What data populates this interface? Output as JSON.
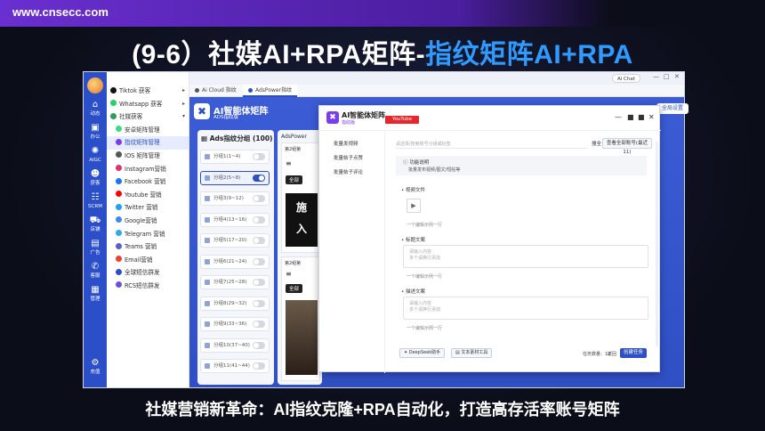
{
  "site_url": "www.cnsecc.com",
  "headline": {
    "part1": "(9-6）社媒AI+RPA矩阵-",
    "part2": "指纹矩阵AI+RPA"
  },
  "caption": "社媒营销新革命：AI指纹克隆+RPA自动化，打造高存活率账号矩阵",
  "rail": [
    {
      "icon": "home-icon",
      "glyph": "⌂",
      "label": "动态"
    },
    {
      "icon": "briefcase-icon",
      "glyph": "▣",
      "label": "办公"
    },
    {
      "icon": "aigc-icon",
      "glyph": "✺",
      "label": "AIGC"
    },
    {
      "icon": "user-icon",
      "glyph": "☻",
      "label": "获客"
    },
    {
      "icon": "scrm-icon",
      "glyph": "☷",
      "label": "SCRM"
    },
    {
      "icon": "cart-icon",
      "glyph": "⛟",
      "label": "店铺"
    },
    {
      "icon": "ads-icon",
      "glyph": "▤",
      "label": "广告"
    },
    {
      "icon": "service-icon",
      "glyph": "✆",
      "label": "客服"
    },
    {
      "icon": "manage-icon",
      "glyph": "▦",
      "label": "管理"
    }
  ],
  "rail_bottom": {
    "icon": "settings-icon",
    "glyph": "⚙",
    "label": "充值"
  },
  "menu": [
    {
      "label": "Tiktok 获客",
      "sub": false,
      "color": "#111111",
      "arrow": "▸"
    },
    {
      "label": "Whatsapp 获客",
      "sub": false,
      "color": "#25d366",
      "arrow": "▸"
    },
    {
      "label": "社媒获客",
      "sub": false,
      "color": "#2f9b5a",
      "arrow": "▾"
    },
    {
      "label": "安卓矩阵管理",
      "sub": true,
      "color": "#3ddc84",
      "arrow": ""
    },
    {
      "label": "指纹矩阵管理",
      "sub": true,
      "color": "#7a3cf0",
      "arrow": "",
      "active": true
    },
    {
      "label": "IOS 矩阵管理",
      "sub": true,
      "color": "#555555",
      "arrow": ""
    },
    {
      "label": "Instagram营销",
      "sub": true,
      "color": "#e1306c",
      "arrow": ""
    },
    {
      "label": "Facebook 营销",
      "sub": true,
      "color": "#1877f2",
      "arrow": ""
    },
    {
      "label": "Youtube 营销",
      "sub": true,
      "color": "#ff0000",
      "arrow": ""
    },
    {
      "label": "Twitter 营销",
      "sub": true,
      "color": "#1da1f2",
      "arrow": ""
    },
    {
      "label": "Google营销",
      "sub": true,
      "color": "#4285f4",
      "arrow": ""
    },
    {
      "label": "Telegram 营销",
      "sub": true,
      "color": "#2aabee",
      "arrow": ""
    },
    {
      "label": "Teams 营销",
      "sub": true,
      "color": "#5b5fc7",
      "arrow": ""
    },
    {
      "label": "Email营销",
      "sub": true,
      "color": "#ea4335",
      "arrow": ""
    },
    {
      "label": "全球短信群发",
      "sub": true,
      "color": "#2b4fc9",
      "arrow": ""
    },
    {
      "label": "RCS短信群发",
      "sub": true,
      "color": "#6b4fd8",
      "arrow": ""
    }
  ],
  "tabs": [
    {
      "label": "Ai Cloud 指纹",
      "color": "#555555"
    },
    {
      "label": "AdsPower指纹",
      "color": "#2b4fc9"
    }
  ],
  "top_right": {
    "chat_label": "Ai Chat"
  },
  "brand": {
    "title": "AI智能体矩阵",
    "subtitle": "ADS指纹版"
  },
  "right_action": "全局设置",
  "groups": {
    "title": "Ads指纹分组 (100)",
    "items": [
      {
        "label": "分组1(1~4)",
        "on": false
      },
      {
        "label": "分组2(5~8)",
        "on": true
      },
      {
        "label": "分组3(9~12)",
        "on": false
      },
      {
        "label": "分组4(13~16)",
        "on": false
      },
      {
        "label": "分组5(17~20)",
        "on": false
      },
      {
        "label": "分组6(21~24)",
        "on": false
      },
      {
        "label": "分组7(25~28)",
        "on": false
      },
      {
        "label": "分组8(29~32)",
        "on": false
      },
      {
        "label": "分组9(33~36)",
        "on": false
      },
      {
        "label": "分组10(37~40)",
        "on": false
      },
      {
        "label": "分组11(41~44)",
        "on": false
      }
    ]
  },
  "cards": {
    "head": "AdsPower",
    "card1_title": "第2组第",
    "card2_title": "第2组第",
    "all_label": "全部",
    "promo1": "施\n入",
    "menu_glyph": "≡"
  },
  "modal": {
    "title": "AI智能体矩阵",
    "subtitle": "指纹版",
    "tag": "YouTube",
    "side": [
      "批量发视频",
      "批量帖子点赞",
      "批量帖子评论"
    ],
    "search_placeholder": "请选择/搜索账号分组或标签",
    "search_btn": "搜全",
    "query_btn": "查看全部账号(最近 11)",
    "feature_title": "功能说明",
    "feature_desc": "批量发布视频/图文/短帖等",
    "video_label": "视频文件",
    "add_one": "一个编辑示例一行",
    "title_label": "标题文案",
    "title_placeholder_1": "请输入内容",
    "title_placeholder_2": "多个请换行添加",
    "content_label": "描述文案",
    "content_placeholder_1": "请输入内容",
    "content_placeholder_2": "多个请换行添加",
    "btn_deepseek": "DeepSeek助手",
    "btn_material": "文本素材工具",
    "footer_count": "任务数量：10",
    "footer_cancel": "返回",
    "create_btn": "创建任务"
  }
}
